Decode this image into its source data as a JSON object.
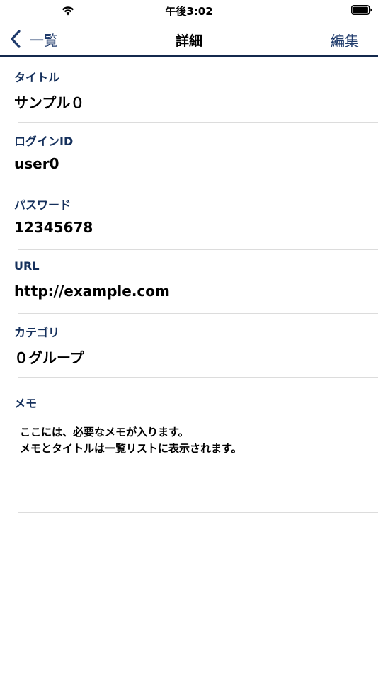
{
  "status_bar": {
    "time": "午後3:02",
    "wifi_icon": "wifi-icon",
    "battery_icon": "battery-icon"
  },
  "nav": {
    "back_label": "一覧",
    "back_icon": "chevron-left-icon",
    "title": "詳細",
    "edit_label": "編集",
    "accent_color": "#1e3a6b"
  },
  "fields": [
    {
      "label": "タイトル",
      "value": "サンプル０"
    },
    {
      "label": "ログインID",
      "value": "user0"
    },
    {
      "label": "パスワード",
      "value": "12345678"
    },
    {
      "label": "URL",
      "value": "http://example.com"
    },
    {
      "label": "カテゴリ",
      "value": "０グループ"
    }
  ],
  "memo": {
    "label": "メモ",
    "lines": [
      "ここには、必要なメモが入ります。",
      "メモとタイトルは一覧リストに表示されます。"
    ]
  }
}
